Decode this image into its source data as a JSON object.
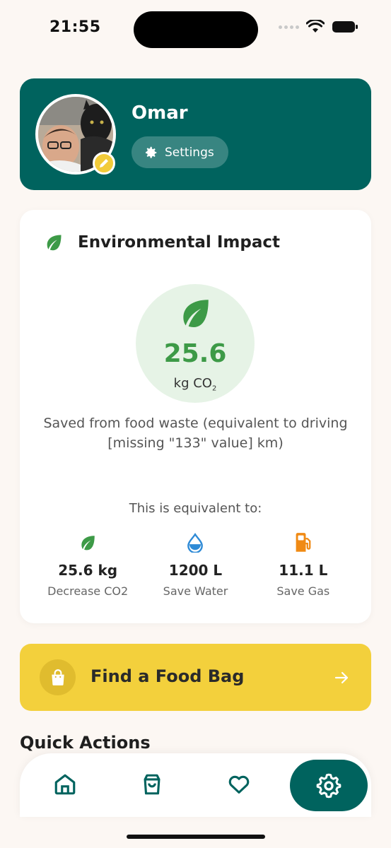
{
  "status_bar": {
    "time": "21:55"
  },
  "profile": {
    "name": "Omar",
    "settings_label": "Settings"
  },
  "impact": {
    "title": "Environmental Impact",
    "value": "25.6",
    "unit": "kg CO",
    "unit_sub": "2",
    "saved_text": "Saved from food waste (equivalent to driving [missing \"133\" value] km)",
    "equivalent_label": "This is equivalent to:",
    "stats": [
      {
        "icon": "leaf-icon",
        "value": "25.6 kg",
        "label": "Decrease CO2"
      },
      {
        "icon": "water-drop-icon",
        "value": "1200 L",
        "label": "Save Water"
      },
      {
        "icon": "fuel-pump-icon",
        "value": "11.1 L",
        "label": "Save Gas"
      }
    ]
  },
  "food_bag": {
    "label": "Find a Food Bag"
  },
  "quick_actions": {
    "title": "Quick Actions"
  },
  "nav": [
    "home-icon",
    "shopping-bag-icon",
    "heart-icon",
    "settings-gear-icon"
  ],
  "colors": {
    "primary": "#00635e",
    "accent": "#f3d03c",
    "green": "#3d9a47",
    "background": "#fcf7f3"
  }
}
